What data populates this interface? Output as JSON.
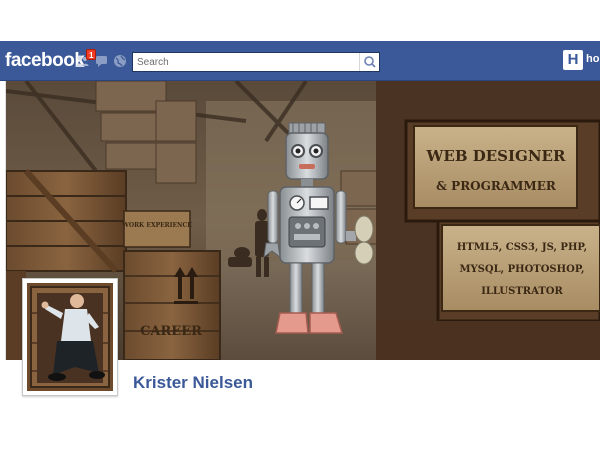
{
  "header": {
    "logo": "facebook",
    "notification_count": "1",
    "search_placeholder": "Search",
    "home_initial": "H",
    "home_label": "hor"
  },
  "cover": {
    "sign_line1": "WEB DESIGNER",
    "sign_line2": "& PROGRAMMER",
    "sign2_line1": "HTML5, CSS3, JS, PHP,",
    "sign2_line2": "MYSQL, PHOTOSHOP,",
    "sign2_line3": "ILLUSTRATOR",
    "crate_label": "CAREER",
    "small_crate_label": "WORK EXPERIENCE"
  },
  "profile": {
    "name": "Krister Nielsen"
  }
}
